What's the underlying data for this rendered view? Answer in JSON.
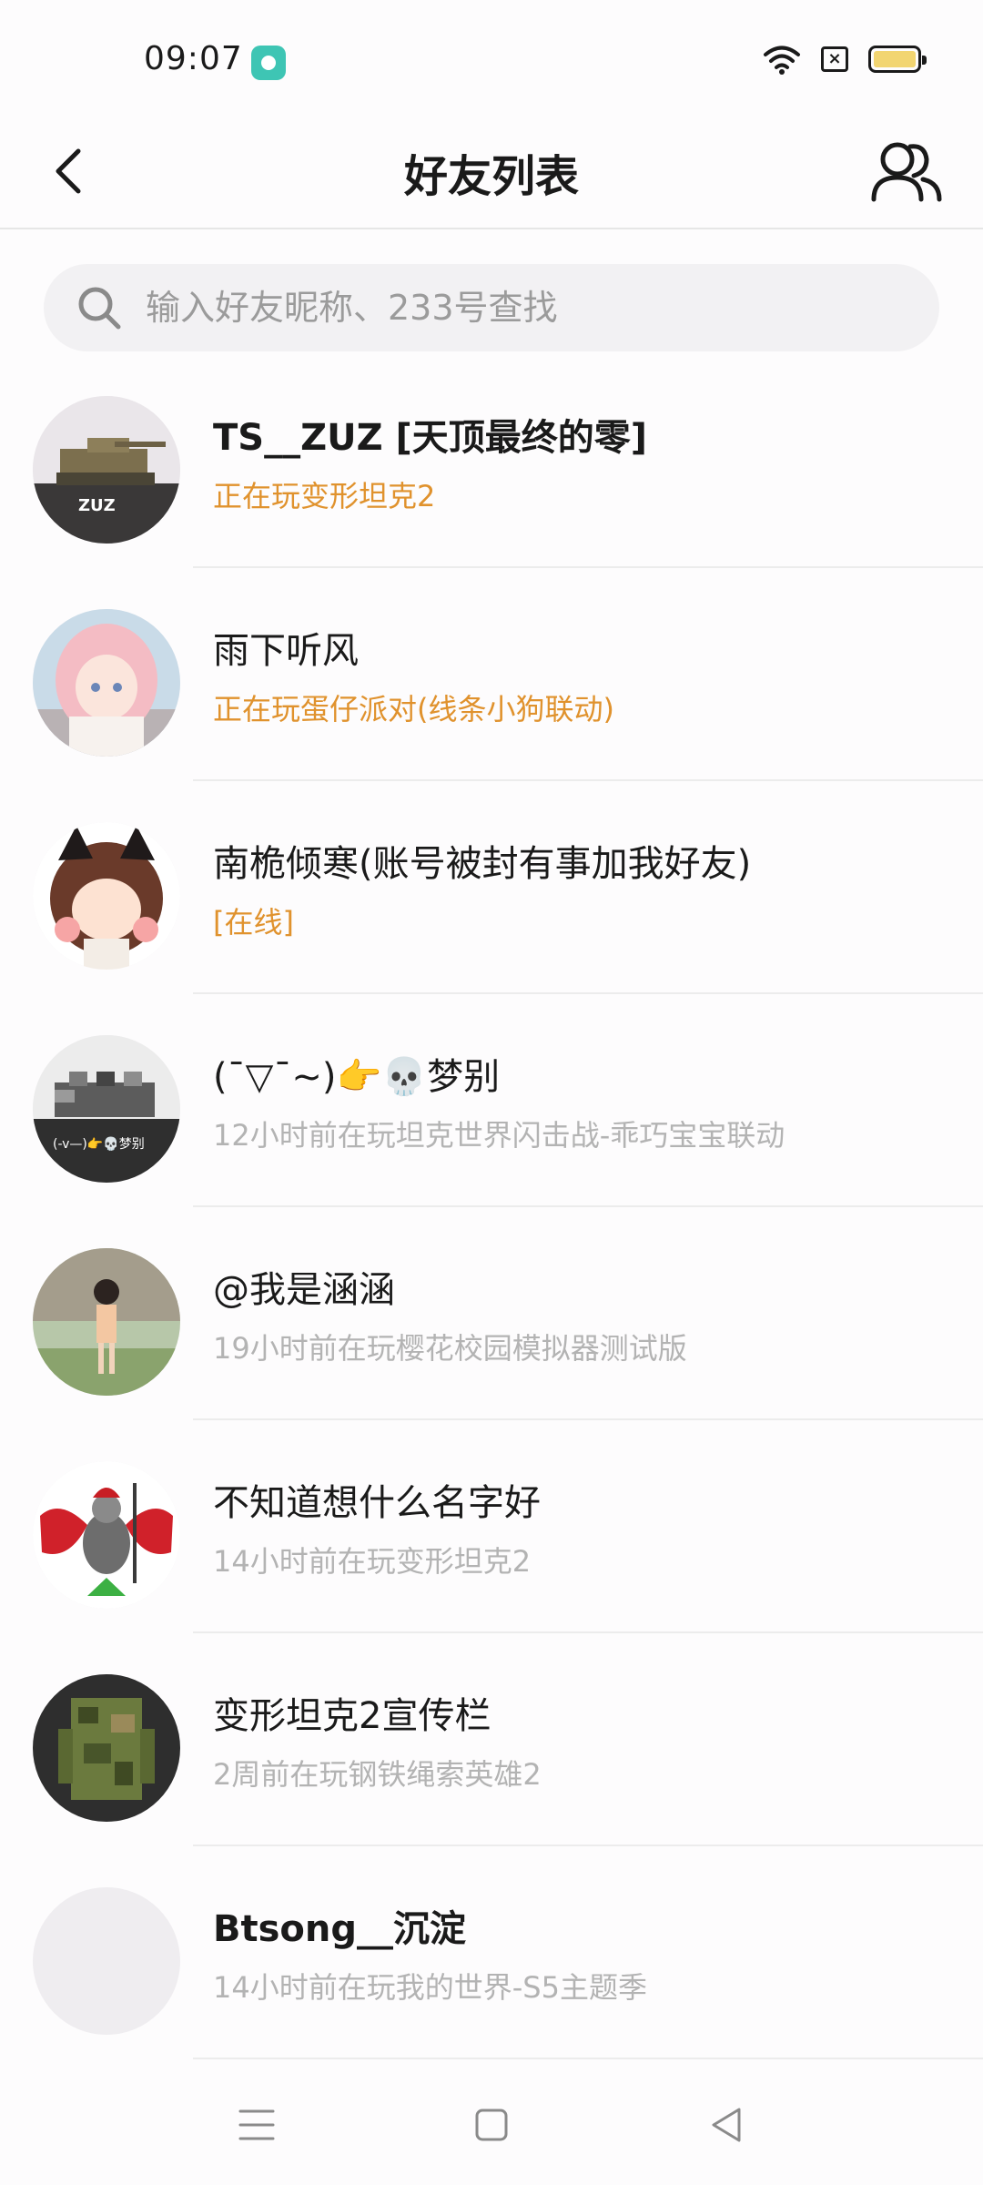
{
  "status_bar": {
    "time": "09:07",
    "icons": [
      "app-notification-icon",
      "wifi-icon",
      "sim-card-icon",
      "battery-icon"
    ],
    "battery_color": "#f2d571"
  },
  "header": {
    "title": "好友列表",
    "back_icon": "chevron-left-icon",
    "contacts_icon": "people-icon"
  },
  "search": {
    "placeholder": "输入好友昵称、233号查找"
  },
  "friends": [
    {
      "name": "TS__ZUZ [天顶最终的零]",
      "status": "正在玩变形坦克2",
      "status_type": "playing",
      "avatar_text": "ZUZ"
    },
    {
      "name": "雨下听风",
      "status": "正在玩蛋仔派对(线条小狗联动)",
      "status_type": "playing",
      "avatar_text": ""
    },
    {
      "name": "南桅倾寒(账号被封有事加我好友)",
      "status": "[在线]",
      "status_type": "playing",
      "avatar_text": ""
    },
    {
      "name": "(¯▽¯~)👉💀梦别",
      "status": "12小时前在玩坦克世界闪击战-乖巧宝宝联动",
      "status_type": "recent",
      "avatar_text": "(-v—)👉💀梦别"
    },
    {
      "name": "@我是涵涵",
      "status": "19小时前在玩樱花校园模拟器测试版",
      "status_type": "recent",
      "avatar_text": ""
    },
    {
      "name": "不知道想什么名字好",
      "status": "14小时前在玩变形坦克2",
      "status_type": "recent",
      "avatar_text": ""
    },
    {
      "name": "变形坦克2宣传栏",
      "status": "2周前在玩钢铁绳索英雄2",
      "status_type": "recent",
      "avatar_text": ""
    },
    {
      "name": "Btsong__沉淀",
      "status": "14小时前在玩我的世界-S5主题季",
      "status_type": "recent",
      "avatar_text": ""
    }
  ],
  "colors": {
    "playing": "#e0922d",
    "recent": "#b3b3b3",
    "search_bg": "#f2f1f3"
  },
  "nav_bar": {
    "icons": [
      "menu-icon",
      "home-square-icon",
      "back-triangle-icon"
    ]
  }
}
